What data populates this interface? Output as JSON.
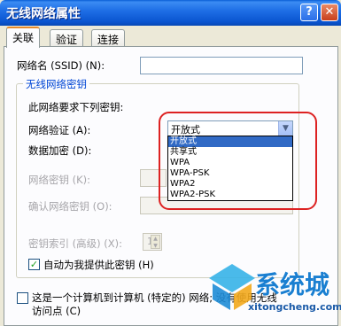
{
  "window": {
    "title": "无线网络属性",
    "help_glyph": "?",
    "close_glyph": "✕"
  },
  "tabs": [
    {
      "label": "关联"
    },
    {
      "label": "验证"
    },
    {
      "label": "连接"
    }
  ],
  "association": {
    "ssid_label": "网络名 (SSID) (N):",
    "ssid_value": "",
    "group_title": "无线网络密钥",
    "requires_key_text": "此网络要求下列密钥:",
    "auth_label": "网络验证 (A):",
    "auth_value": "开放式",
    "auth_options": [
      "开放式",
      "共享式",
      "WPA",
      "WPA-PSK",
      "WPA2",
      "WPA2-PSK"
    ],
    "auth_selected_index": 0,
    "encryption_label": "数据加密 (D):",
    "key_label": "网络密钥 (K):",
    "confirm_key_label": "确认网络密钥 (O):",
    "key_index_label": "密钥索引 (高级) (X):",
    "key_index_value": "1",
    "auto_key_label": "自动为我提供此密钥 (H)",
    "auto_key_checked": true,
    "adhoc_label_line1": "这是一个计算机到计算机 (特定的) 网络; 没有使用无线",
    "adhoc_label_line2": "访问点 (C)",
    "adhoc_checked": false
  },
  "watermark": {
    "brand": "系统城",
    "url": "xitongcheng.com"
  },
  "colors": {
    "title_bar": "#0a55d0",
    "selection": "#316ac5",
    "highlight": "#dd2222",
    "group_title": "#0046d5"
  }
}
